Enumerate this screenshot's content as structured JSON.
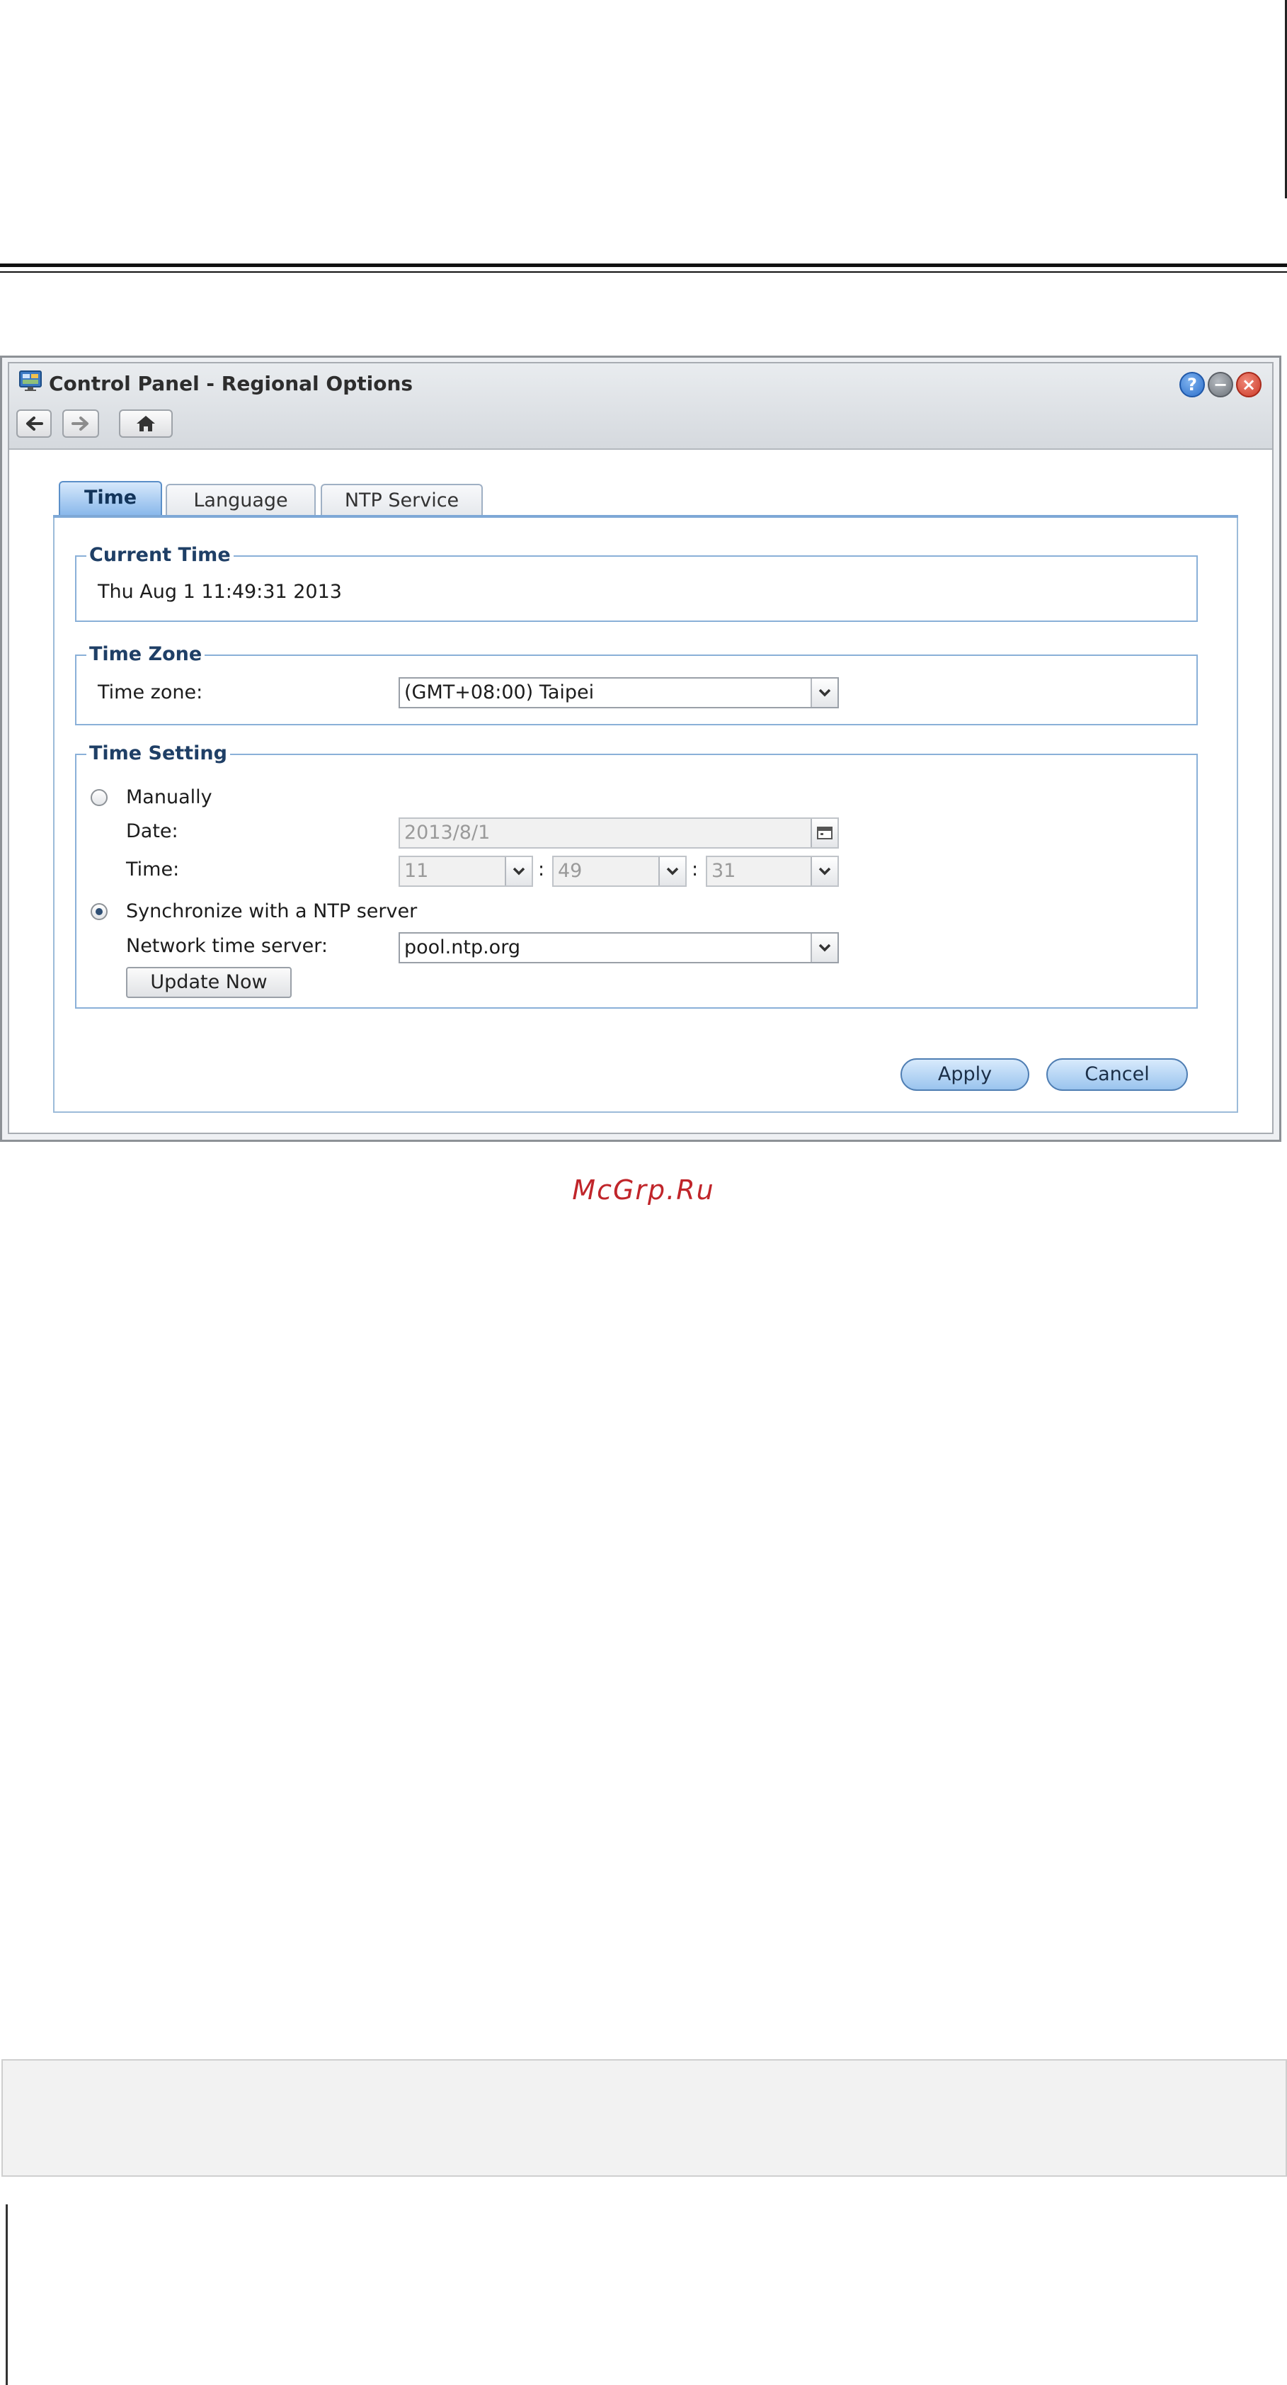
{
  "window": {
    "title": "Control Panel - Regional Options",
    "controls": [
      "help-icon",
      "minimize-icon",
      "close-icon"
    ]
  },
  "nav": {
    "icons": [
      "back-arrow-icon",
      "forward-arrow-icon",
      "home-icon"
    ]
  },
  "tabs": [
    {
      "label": "Time",
      "active": true
    },
    {
      "label": "Language",
      "active": false
    },
    {
      "label": "NTP Service",
      "active": false
    }
  ],
  "current_time": {
    "legend": "Current Time",
    "value": "Thu Aug 1 11:49:31 2013"
  },
  "time_zone": {
    "legend": "Time Zone",
    "label": "Time zone:",
    "selected": "(GMT+08:00) Taipei"
  },
  "time_setting": {
    "legend": "Time Setting",
    "manual": {
      "label": "Manually",
      "selected": false,
      "date_label": "Date:",
      "date_value": "2013/8/1",
      "time_label": "Time:",
      "hour": "11",
      "minute": "49",
      "second": "31",
      "separator": ":"
    },
    "ntp": {
      "label": "Synchronize with a NTP server",
      "selected": true,
      "server_label": "Network time server:",
      "server_value": "pool.ntp.org",
      "update_button": "Update Now"
    }
  },
  "footer": {
    "apply": "Apply",
    "cancel": "Cancel"
  },
  "watermark": "McGrp.Ru",
  "colors": {
    "accent": "#86b6ea",
    "border": "#8ab0d8",
    "legend": "#1f3f66",
    "watermark": "#c0252a"
  }
}
